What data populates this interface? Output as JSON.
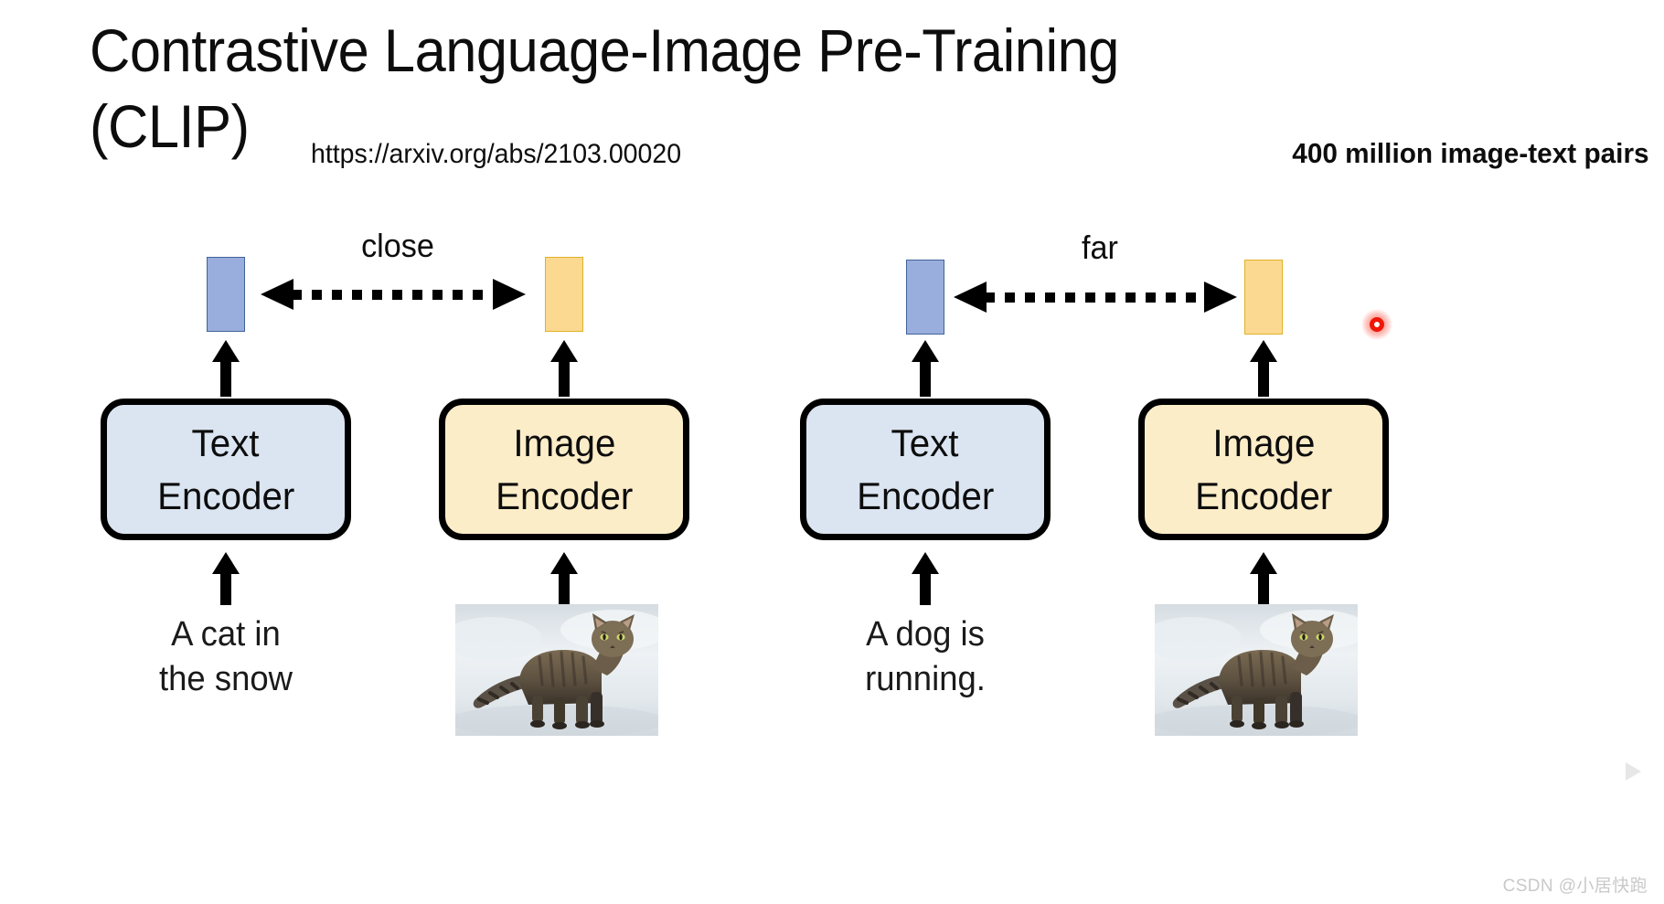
{
  "header": {
    "title": "Contrastive Language-Image Pre-Training\n(CLIP)",
    "paper_link": "https://arxiv.org/abs/2103.00020",
    "dataset_note": "400 million image-text pairs"
  },
  "pairs": [
    {
      "id": "matching-pair",
      "relation_label": "close",
      "text_branch": {
        "embedding_name": "text-embedding",
        "encoder_lines": [
          "Text",
          "Encoder"
        ],
        "input_caption": "A cat in\nthe snow"
      },
      "image_branch": {
        "embedding_name": "image-embedding",
        "encoder_lines": [
          "Image",
          "Encoder"
        ],
        "input_image_alt": "A tabby cat standing in snow"
      }
    },
    {
      "id": "mismatching-pair",
      "relation_label": "far",
      "text_branch": {
        "embedding_name": "text-embedding",
        "encoder_lines": [
          "Text",
          "Encoder"
        ],
        "input_caption": "A dog is\nrunning."
      },
      "image_branch": {
        "embedding_name": "image-embedding",
        "encoder_lines": [
          "Image",
          "Encoder"
        ],
        "input_image_alt": "A tabby cat standing in snow"
      }
    }
  ],
  "overlays": {
    "cursor_marker": "red-click-marker",
    "video_badge": "play-tv-icon",
    "watermark": "CSDN @小居快跑"
  },
  "colors": {
    "text_embedding_fill": "#9aaedd",
    "text_embedding_border": "#41629a",
    "image_embedding_fill": "#fcd990",
    "image_embedding_border": "#dfb128",
    "text_encoder_fill": "#dbe5f1",
    "image_encoder_fill": "#fcedc9",
    "encoder_border": "#000000",
    "arrow": "#000000",
    "cursor_red": "#f01707",
    "watermark_gray": "#c9c9c9"
  }
}
